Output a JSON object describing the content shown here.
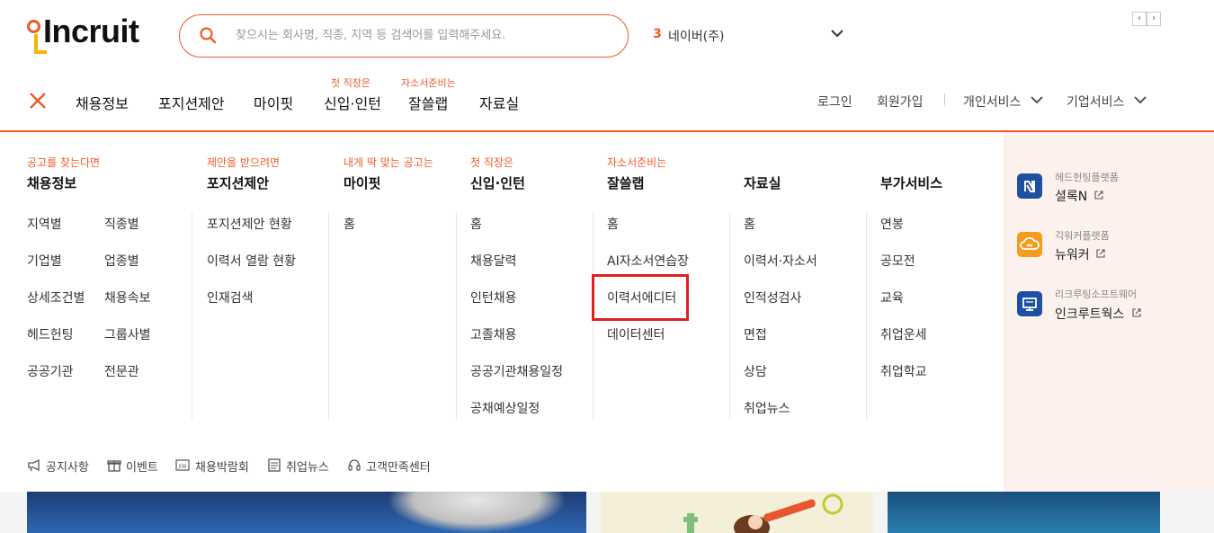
{
  "header": {
    "brand": "Incruit",
    "search_placeholder": "찾으시는 회사명, 직종, 지역 등 검색어를 입력해주세요.",
    "rank_number": "3",
    "rank_word": "네이버(주)",
    "pager_prev": "‹",
    "pager_next": "›"
  },
  "gnb": {
    "items": [
      {
        "label": "채용정보",
        "tag": ""
      },
      {
        "label": "포지션제안",
        "tag": ""
      },
      {
        "label": "마이핏",
        "tag": ""
      },
      {
        "label": "신입·인턴",
        "tag": "첫 직장은"
      },
      {
        "label": "잘쓸랩",
        "tag": "자소서준비는"
      },
      {
        "label": "자료실",
        "tag": ""
      }
    ],
    "util": {
      "login": "로그인",
      "signup": "회원가입",
      "personal": "개인서비스",
      "corporate": "기업서비스"
    }
  },
  "menu": {
    "columns": [
      {
        "tag": "공고를 찾는다면",
        "title": "채용정보",
        "links": [
          "지역별",
          "직종별",
          "기업별",
          "업종별",
          "상세조건별",
          "채용속보",
          "헤드헌팅",
          "그룹사별",
          "공공기관",
          "전문관"
        ]
      },
      {
        "tag": "제안을 받으려면",
        "title": "포지션제안",
        "links": [
          "포지션제안 현황",
          "이력서 열람 현황",
          "인재검색"
        ]
      },
      {
        "tag": "내게 딱 맞는 공고는",
        "title": "마이핏",
        "links": [
          "홈"
        ]
      },
      {
        "tag": "첫 직장은",
        "title": "신입·인턴",
        "links": [
          "홈",
          "채용달력",
          "인턴채용",
          "고졸채용",
          "공공기관채용일정",
          "공채예상일정"
        ]
      },
      {
        "tag": "자소서준비는",
        "title": "잘쓸랩",
        "links": [
          "홈",
          "AI자소서연습장",
          "이력서에디터",
          "데이터센터"
        ]
      },
      {
        "tag": "",
        "title": "자료실",
        "links": [
          "홈",
          "이력서·자소서",
          "인적성검사",
          "면접",
          "상담",
          "취업뉴스"
        ]
      },
      {
        "tag": "",
        "title": "부가서비스",
        "links": [
          "연봉",
          "공모전",
          "교육",
          "취업운세",
          "취업학교"
        ]
      }
    ],
    "side_services": [
      {
        "sub": "헤드헌팅플랫폼",
        "name": "셜록N",
        "color": "#1d4fa3",
        "icon": "n-logo-icon"
      },
      {
        "sub": "긱워커플랫폼",
        "name": "뉴워커",
        "color": "#f59b1e",
        "icon": "cloud-icon"
      },
      {
        "sub": "리크루팅소프트웨어",
        "name": "인크루트웍스",
        "color": "#1d4fa3",
        "icon": "monitor-icon"
      }
    ],
    "bottom_links": [
      "공지사항",
      "이벤트",
      "채용박람회",
      "취업뉴스",
      "고객만족센터"
    ]
  },
  "colors": {
    "accent": "#f05a28",
    "highlight": "#e0201f"
  }
}
